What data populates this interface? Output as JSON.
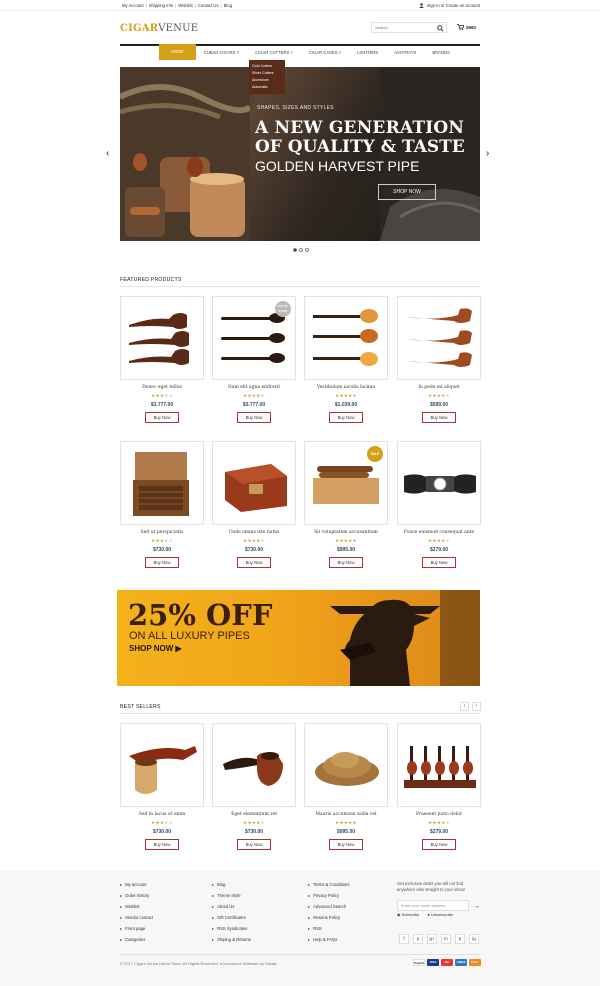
{
  "topbar": {
    "links": [
      "My Account",
      "Shipping Info",
      "Wishlist",
      "Contact Us",
      "Blog"
    ],
    "separator": "|",
    "signin": "Sign In or Create an account"
  },
  "header": {
    "logo_a": "CIGAR",
    "logo_b": "VENUE",
    "search_placeholder": "Search",
    "cart_total": "$980"
  },
  "nav": {
    "items": [
      "HOME",
      "CUBAN CIGARS",
      "CIGAR CUTTERS",
      "CIGAR CASES",
      "LIGHTERS",
      "ASHTRAYS",
      "BRANDS"
    ],
    "dropdown": [
      "Gold Cutters",
      "Silver Cutters",
      "Aluminium",
      "Automatic"
    ]
  },
  "hero": {
    "sub": "SHAPES, SIZES AND STYLES",
    "line1": "A NEW GENERATION",
    "line2": "OF QUALITY & TASTE",
    "line3": "GOLDEN HARVEST PIPE",
    "button": "SHOP NOW"
  },
  "featured": {
    "title": "FEATURED PRODUCTS",
    "buy_label": "Buy Now",
    "badge_sale": "SALE",
    "badge_out": "OUT OF STOCK",
    "products": [
      {
        "name": "Donec eget tellus",
        "price": "$3.777.00",
        "rating": 3
      },
      {
        "name": "Nam elit agna endrerit",
        "price": "$3.777.00",
        "rating": 4
      },
      {
        "name": "Vestibulum iaculis lacinia",
        "price": "$1.039.00",
        "rating": 5
      },
      {
        "name": "In pede mi aliquet",
        "price": "$599.00",
        "rating": 4
      },
      {
        "name": "Sed ut perspiciatis",
        "price": "$730.00",
        "rating": 3
      },
      {
        "name": "Unde omnis iste natus",
        "price": "$730.00",
        "rating": 4
      },
      {
        "name": "Sit voluptatem accusantium",
        "price": "$995.00",
        "rating": 5
      },
      {
        "name": "Fusce euismod consequat ante",
        "price": "$279.00",
        "rating": 4
      }
    ]
  },
  "promo": {
    "big": "25% OFF",
    "sub": "ON ALL LUXURY PIPES",
    "cta": "SHOP NOW ▶"
  },
  "bestsellers": {
    "title": "BEST SELLERS",
    "products": [
      {
        "name": "Sed in lacus ut enim",
        "price": "$730.00",
        "rating": 3
      },
      {
        "name": "Eget elementum vel",
        "price": "$730.00",
        "rating": 4
      },
      {
        "name": "Mauris accumsan nulla vel",
        "price": "$995.00",
        "rating": 5
      },
      {
        "name": "Praesent justo dolor",
        "price": "$279.00",
        "rating": 4
      }
    ]
  },
  "footer": {
    "col1": [
      "My account",
      "Order history",
      "Wishlist",
      "Vendor contact",
      "Front page",
      "Categories"
    ],
    "col2": [
      "Blog",
      "Theme Style",
      "About Us",
      "Gift Certificates",
      "RSS Syndicates",
      "Shiping & Returns"
    ],
    "col3": [
      "Terms & Conditions",
      "Privacy Policy",
      "Advanced Search",
      "Returns Policy",
      "RSS",
      "Help & FAQs"
    ],
    "news_text": "Get exclusive deals you will not find anywhere else straight to your inbox!",
    "email_placeholder": "Enter your email address",
    "subscribe": "Subscribe",
    "unsubscribe": "Unsubscribe",
    "social": [
      "f",
      "y",
      "g+",
      "in",
      "p",
      "ig"
    ],
    "copyright": "© 2017 Cigars Venue Demo Store. All Rights Reserved. eCommerce Software by Sitcart.",
    "payments": [
      "PayPal",
      "VISA",
      "MC",
      "AMEX",
      "DISC"
    ]
  },
  "colors": {
    "accent": "#d4a017",
    "price": "#2c4a6a",
    "dropdown": "#5a2a1a"
  }
}
